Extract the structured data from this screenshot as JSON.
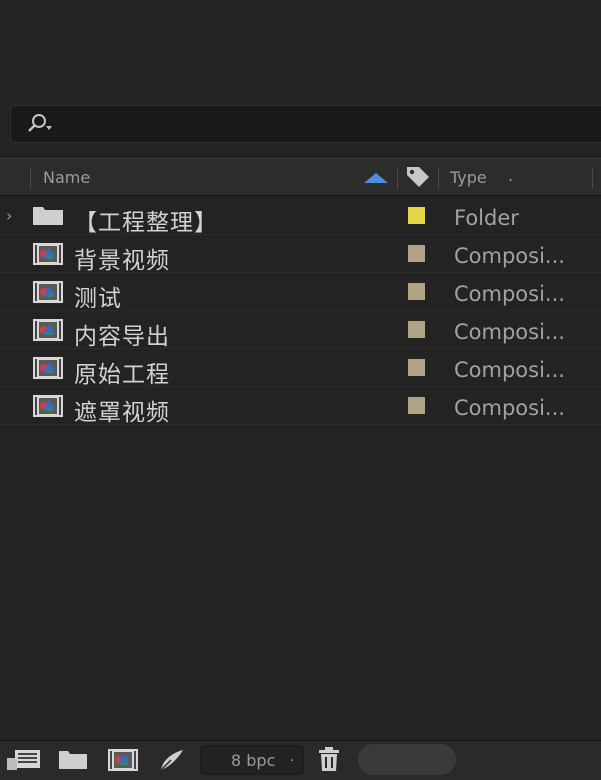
{
  "search": {
    "placeholder": ""
  },
  "columns": {
    "name": "Name",
    "type": "Type",
    "type_suffix": "."
  },
  "items": [
    {
      "name": "【工程整理】",
      "type": "Folder",
      "kind": "folder",
      "label_color": "#e3d646",
      "expandable": true
    },
    {
      "name": "背景视频",
      "type": "Composi...",
      "kind": "composition",
      "label_color": "#b1a386",
      "expandable": false
    },
    {
      "name": "测试",
      "type": "Composi...",
      "kind": "composition",
      "label_color": "#b1a386",
      "expandable": false
    },
    {
      "name": "内容导出",
      "type": "Composi...",
      "kind": "composition",
      "label_color": "#b1a386",
      "expandable": false
    },
    {
      "name": "原始工程",
      "type": "Composi...",
      "kind": "composition",
      "label_color": "#b1a386",
      "expandable": false
    },
    {
      "name": "遮罩视频",
      "type": "Composi...",
      "kind": "composition",
      "label_color": "#b1a386",
      "expandable": false
    }
  ],
  "footer": {
    "bpc": "8 bpc",
    "bpc_suffix": "."
  },
  "colors": {
    "sort_arrow": "#4a90e2"
  }
}
